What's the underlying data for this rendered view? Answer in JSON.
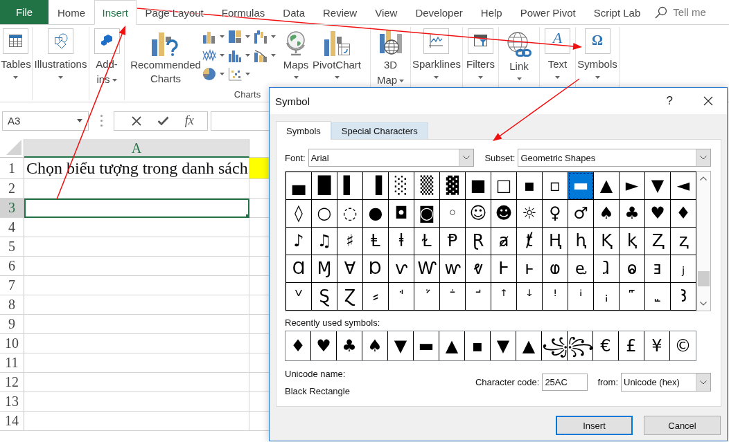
{
  "ribbon_tabs": [
    {
      "label": "File",
      "kind": "file",
      "selected": false
    },
    {
      "label": "Home",
      "kind": "tab",
      "selected": false
    },
    {
      "label": "Insert",
      "kind": "tab",
      "selected": true
    },
    {
      "label": "Page Layout",
      "kind": "tab",
      "selected": false
    },
    {
      "label": "Formulas",
      "kind": "tab",
      "selected": false
    },
    {
      "label": "Data",
      "kind": "tab",
      "selected": false
    },
    {
      "label": "Review",
      "kind": "tab",
      "selected": false
    },
    {
      "label": "View",
      "kind": "tab",
      "selected": false
    },
    {
      "label": "Developer",
      "kind": "tab",
      "selected": false
    },
    {
      "label": "Help",
      "kind": "tab",
      "selected": false
    },
    {
      "label": "Power Pivot",
      "kind": "tab",
      "selected": false
    },
    {
      "label": "Script Lab",
      "kind": "tab",
      "selected": false
    }
  ],
  "tell_me": {
    "placeholder": "Tell me"
  },
  "ribbon": {
    "buttons": [
      {
        "label": "Tables"
      },
      {
        "label": "Illustrations"
      },
      {
        "label": "Add-ins"
      },
      {
        "label": "Recommended Charts"
      },
      {
        "label": "Maps"
      },
      {
        "label": "PivotChart"
      },
      {
        "label": "3D Map"
      },
      {
        "label": "Sparklines"
      },
      {
        "label": "Filters"
      },
      {
        "label": "Link"
      },
      {
        "label": "Text",
        "glyph": "A"
      },
      {
        "label": "Symbols",
        "glyph": "Ω"
      }
    ],
    "charts_group_label": "Charts"
  },
  "formula_bar": {
    "name_box": "A3",
    "function_label": "fx"
  },
  "sheet": {
    "columns": [
      {
        "label": "A",
        "selected": true
      }
    ],
    "rows": [
      {
        "header": "1",
        "selected": false,
        "cells": [
          {
            "text": "Chọn biểu tượng trong danh sách"
          },
          {
            "color": "#ffff00"
          }
        ]
      },
      {
        "header": "2",
        "selected": false
      },
      {
        "header": "3",
        "selected": true
      },
      {
        "header": "4",
        "selected": false
      },
      {
        "header": "5",
        "selected": false
      },
      {
        "header": "6",
        "selected": false
      },
      {
        "header": "7",
        "selected": false
      },
      {
        "header": "8",
        "selected": false
      },
      {
        "header": "9",
        "selected": false
      },
      {
        "header": "10",
        "selected": false
      },
      {
        "header": "11",
        "selected": false
      },
      {
        "header": "12",
        "selected": false
      },
      {
        "header": "13",
        "selected": false
      },
      {
        "header": "14",
        "selected": false
      }
    ]
  },
  "dialog": {
    "title": "Symbol",
    "help": "?",
    "tabs": [
      {
        "label": "Symbols",
        "selected": true,
        "hovered": false
      },
      {
        "label": "Special Characters",
        "selected": false,
        "hovered": true
      }
    ],
    "font": {
      "label": "Font:",
      "value": "Arial"
    },
    "subset": {
      "label": "Subset:",
      "value": "Geometric Shapes"
    },
    "symbol_rows": [
      [
        {
          "symbol": "▄",
          "selected": false
        },
        {
          "symbol": "█",
          "selected": false
        },
        {
          "symbol": "▌",
          "selected": false
        },
        {
          "symbol": "▐",
          "selected": false
        },
        {
          "symbol": "░",
          "selected": false
        },
        {
          "symbol": "▒",
          "selected": false
        },
        {
          "symbol": "▓",
          "selected": false
        },
        {
          "symbol": "■",
          "selected": false
        },
        {
          "symbol": "□",
          "selected": false
        },
        {
          "symbol": "▪",
          "selected": false
        },
        {
          "symbol": "▫",
          "selected": false
        },
        {
          "symbol": "▬",
          "selected": true
        },
        {
          "symbol": "▲",
          "selected": false
        },
        {
          "symbol": "►",
          "selected": false
        },
        {
          "symbol": "▼",
          "selected": false
        },
        {
          "symbol": "◄",
          "selected": false
        }
      ],
      [
        {
          "symbol": "◊",
          "selected": false
        },
        {
          "symbol": "○",
          "selected": false
        },
        {
          "symbol": "◌",
          "selected": false
        },
        {
          "symbol": "●",
          "selected": false
        },
        {
          "symbol": "◘",
          "selected": false
        },
        {
          "symbol": "◙",
          "selected": false
        },
        {
          "symbol": "◦",
          "selected": false
        },
        {
          "symbol": "☺",
          "selected": false
        },
        {
          "symbol": "☻",
          "selected": false
        },
        {
          "symbol": "☼",
          "selected": false
        },
        {
          "symbol": "♀",
          "selected": false
        },
        {
          "symbol": "♂",
          "selected": false
        },
        {
          "symbol": "♠",
          "selected": false
        },
        {
          "symbol": "♣",
          "selected": false
        },
        {
          "symbol": "♥",
          "selected": false
        },
        {
          "symbol": "♦",
          "selected": false
        }
      ],
      [
        {
          "symbol": "♪",
          "selected": false
        },
        {
          "symbol": "♫",
          "selected": false
        },
        {
          "symbol": "♯",
          "selected": false
        },
        {
          "symbol": "Ⱡ",
          "selected": false
        },
        {
          "symbol": "ⱡ",
          "selected": false
        },
        {
          "symbol": "Ɫ",
          "selected": false
        },
        {
          "symbol": "Ᵽ",
          "selected": false
        },
        {
          "symbol": "Ɽ",
          "selected": false
        },
        {
          "symbol": "ⱥ",
          "selected": false
        },
        {
          "symbol": "ⱦ",
          "selected": false
        },
        {
          "symbol": "Ⱨ",
          "selected": false
        },
        {
          "symbol": "ⱨ",
          "selected": false
        },
        {
          "symbol": "Ⱪ",
          "selected": false
        },
        {
          "symbol": "ⱪ",
          "selected": false
        },
        {
          "symbol": "Ⱬ",
          "selected": false
        },
        {
          "symbol": "ⱬ",
          "selected": false
        }
      ],
      [
        {
          "symbol": "Ɑ",
          "selected": false
        },
        {
          "symbol": "Ɱ",
          "selected": false
        },
        {
          "symbol": "Ɐ",
          "selected": false
        },
        {
          "symbol": "Ɒ",
          "selected": false
        },
        {
          "symbol": "ⱱ",
          "selected": false
        },
        {
          "symbol": "Ⱳ",
          "selected": false
        },
        {
          "symbol": "ⱳ",
          "selected": false
        },
        {
          "symbol": "ⱴ",
          "selected": false
        },
        {
          "symbol": "Ⱶ",
          "selected": false
        },
        {
          "symbol": "ⱶ",
          "selected": false
        },
        {
          "symbol": "ⱷ",
          "selected": false
        },
        {
          "symbol": "ⱸ",
          "selected": false
        },
        {
          "symbol": "ⱹ",
          "selected": false
        },
        {
          "symbol": "ⱺ",
          "selected": false
        },
        {
          "symbol": "ⱻ",
          "selected": false
        },
        {
          "symbol": "ⱼ",
          "selected": false
        }
      ],
      [
        {
          "symbol": "ⱽ",
          "selected": false
        },
        {
          "symbol": "Ȿ",
          "selected": false
        },
        {
          "symbol": "Ɀ",
          "selected": false
        },
        {
          "symbol": "⸗",
          "selected": false
        },
        {
          "symbol": "ꜗ",
          "selected": false
        },
        {
          "symbol": "ꜘ",
          "selected": false
        },
        {
          "symbol": "ꜙ",
          "selected": false
        },
        {
          "symbol": "ꜚ",
          "selected": false
        },
        {
          "symbol": "ꜛ",
          "selected": false
        },
        {
          "symbol": "ꜜ",
          "selected": false
        },
        {
          "symbol": "ꜝ",
          "selected": false
        },
        {
          "symbol": "ꜞ",
          "selected": false
        },
        {
          "symbol": "ꜟ",
          "selected": false
        },
        {
          "symbol": "꜠",
          "selected": false
        },
        {
          "symbol": "꜡",
          "selected": false
        },
        {
          "symbol": "Ꜣ",
          "selected": false
        }
      ]
    ],
    "recent_label": "Recently used symbols:",
    "recent_symbols": [
      "♦",
      "♥",
      "♣",
      "♠",
      "▼",
      "▬",
      "▲",
      "▪",
      "▼",
      "▲",
      "꧁",
      "꧂",
      "€",
      "£",
      "¥",
      "©"
    ],
    "unicode_name_label": "Unicode name:",
    "unicode_name": "Black Rectangle",
    "character_code": {
      "label": "Character code:",
      "value": "25AC"
    },
    "from": {
      "label": "from:",
      "value": "Unicode (hex)"
    },
    "buttons": [
      {
        "label": "Insert",
        "default": true
      },
      {
        "label": "Cancel",
        "default": false
      }
    ]
  }
}
